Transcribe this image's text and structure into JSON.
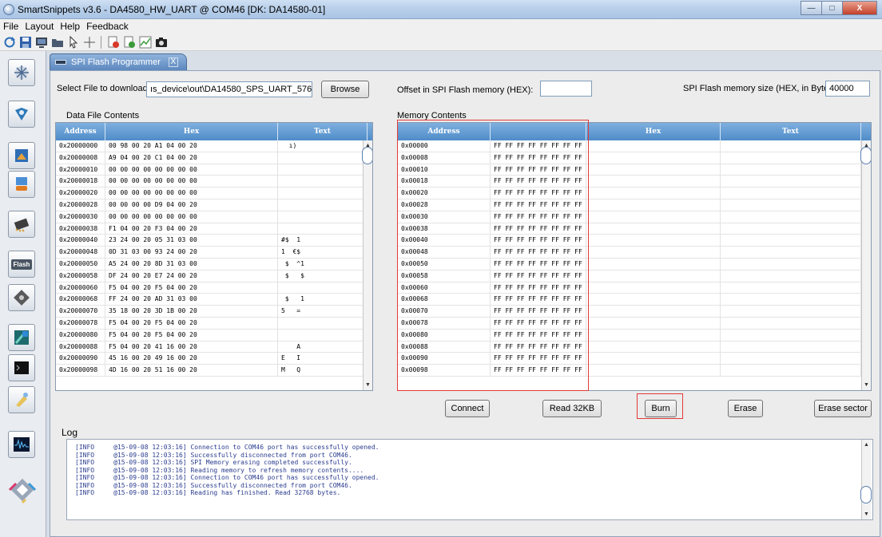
{
  "window": {
    "title": "SmartSnippets v3.6 - DA4580_HW_UART @ COM46  [DK: DA14580-01]",
    "minimize": "—",
    "maximize": "□",
    "close": "X"
  },
  "menu": [
    "File",
    "Layout",
    "Help",
    "Feedback"
  ],
  "toolbar_icons": [
    "refresh-icon",
    "save-icon",
    "monitor-icon",
    "folder-icon",
    "pointer-icon",
    "crosshair-icon",
    "export-red-icon",
    "import-green-icon",
    "chart-icon",
    "camera-icon"
  ],
  "sidebar_icons": [
    "settings-sparkle-icon",
    "board-setup-icon",
    "chip-programmer-icon",
    "otp-header-icon",
    "eeprom-icon",
    "flash-icon",
    "booter-icon",
    "layout-icon",
    "terminal-icon",
    "sleep-mode-icon",
    "power-profiler-icon",
    "smart-logo"
  ],
  "sidebar_flash_label": "Flash",
  "tab": {
    "label": "SPI Flash Programmer",
    "close": "X"
  },
  "file": {
    "label": "Select File to download:",
    "value": "ıs_device\\out\\DA14580_SPS_UART_57600.hex",
    "browse": "Browse"
  },
  "offset": {
    "label": "Offset in SPI Flash memory (HEX):",
    "value": ""
  },
  "flash_size": {
    "label": "SPI Flash memory size (HEX, in Bytes):",
    "value": "40000"
  },
  "data_file": {
    "title": "Data File Contents",
    "headers": [
      "Address",
      "Hex",
      "Text"
    ],
    "rows": [
      [
        "0x20000000",
        "00 98 00 20 A1 04 00 20",
        "  ı)"
      ],
      [
        "0x20000008",
        "A9 04 00 20 C1 04 00 20",
        ""
      ],
      [
        "0x20000010",
        "00 00 00 00 00 00 00 00",
        ""
      ],
      [
        "0x20000018",
        "00 00 00 00 00 00 00 00",
        ""
      ],
      [
        "0x20000020",
        "00 00 00 00 00 00 00 00",
        ""
      ],
      [
        "0x20000028",
        "00 00 00 00 D9 04 00 20",
        ""
      ],
      [
        "0x20000030",
        "00 00 00 00 00 00 00 00",
        ""
      ],
      [
        "0x20000038",
        "F1 04 00 20 F3 04 00 20",
        ""
      ],
      [
        "0x20000040",
        "23 24 00 20 05 31 03 00",
        "#$  1"
      ],
      [
        "0x20000048",
        "0D 31 03 00 93 24 00 20",
        "1  €$"
      ],
      [
        "0x20000050",
        "A5 24 00 20 8D 31 03 00",
        " $  ^1"
      ],
      [
        "0x20000058",
        "DF 24 00 20 E7 24 00 20",
        " $   $"
      ],
      [
        "0x20000060",
        "F5 04 00 20 F5 04 00 20",
        ""
      ],
      [
        "0x20000068",
        "FF 24 00 20 AD 31 03 00",
        " $   1"
      ],
      [
        "0x20000070",
        "35 18 00 20 3D 1B 00 20",
        "5   ="
      ],
      [
        "0x20000078",
        "F5 04 00 20 F5 04 00 20",
        ""
      ],
      [
        "0x20000080",
        "F5 04 00 20 F5 04 00 20",
        ""
      ],
      [
        "0x20000088",
        "F5 04 00 20 41 16 00 20",
        "    A"
      ],
      [
        "0x20000090",
        "45 16 00 20 49 16 00 20",
        "E   I"
      ],
      [
        "0x20000098",
        "4D 16 00 20 51 16 00 20",
        "M   Q"
      ]
    ]
  },
  "memory": {
    "title": "Memory Contents",
    "headers": [
      "Address",
      "",
      "Hex",
      "Text"
    ],
    "rows": [
      [
        "0x00000",
        "FF FF FF FF FF FF FF FF"
      ],
      [
        "0x00008",
        "FF FF FF FF FF FF FF FF"
      ],
      [
        "0x00010",
        "FF FF FF FF FF FF FF FF"
      ],
      [
        "0x00018",
        "FF FF FF FF FF FF FF FF"
      ],
      [
        "0x00020",
        "FF FF FF FF FF FF FF FF"
      ],
      [
        "0x00028",
        "FF FF FF FF FF FF FF FF"
      ],
      [
        "0x00030",
        "FF FF FF FF FF FF FF FF"
      ],
      [
        "0x00038",
        "FF FF FF FF FF FF FF FF"
      ],
      [
        "0x00040",
        "FF FF FF FF FF FF FF FF"
      ],
      [
        "0x00048",
        "FF FF FF FF FF FF FF FF"
      ],
      [
        "0x00050",
        "FF FF FF FF FF FF FF FF"
      ],
      [
        "0x00058",
        "FF FF FF FF FF FF FF FF"
      ],
      [
        "0x00060",
        "FF FF FF FF FF FF FF FF"
      ],
      [
        "0x00068",
        "FF FF FF FF FF FF FF FF"
      ],
      [
        "0x00070",
        "FF FF FF FF FF FF FF FF"
      ],
      [
        "0x00078",
        "FF FF FF FF FF FF FF FF"
      ],
      [
        "0x00080",
        "FF FF FF FF FF FF FF FF"
      ],
      [
        "0x00088",
        "FF FF FF FF FF FF FF FF"
      ],
      [
        "0x00090",
        "FF FF FF FF FF FF FF FF"
      ],
      [
        "0x00098",
        "FF FF FF FF FF FF FF FF"
      ]
    ]
  },
  "actions": {
    "connect": "Connect",
    "read": "Read 32KB",
    "burn": "Burn",
    "erase": "Erase",
    "erase_sector": "Erase sector"
  },
  "log": {
    "title": "Log",
    "lines": [
      "[INFO     @15-09-08 12:03:16] Connection to COM46 port has successfully opened.",
      "[INFO     @15-09-08 12:03:16] Successfully disconnected from port COM46.",
      "[INFO     @15-09-08 12:03:16] SPI Memory erasing completed successfully.",
      "[INFO     @15-09-08 12:03:16] Reading memory to refresh memory contents....",
      "[INFO     @15-09-08 12:03:16] Connection to COM46 port has successfully opened.",
      "[INFO     @15-09-08 12:03:16] Successfully disconnected from port COM46.",
      "[INFO     @15-09-08 12:03:16] Reading has finished. Read 32768 bytes."
    ]
  },
  "scroll_arrows": {
    "up": "▲",
    "down": "▼"
  },
  "colors": {
    "table_header": "#5a95cf",
    "highlight_box": "#e23a3a",
    "log_text": "#2b3d8f"
  }
}
